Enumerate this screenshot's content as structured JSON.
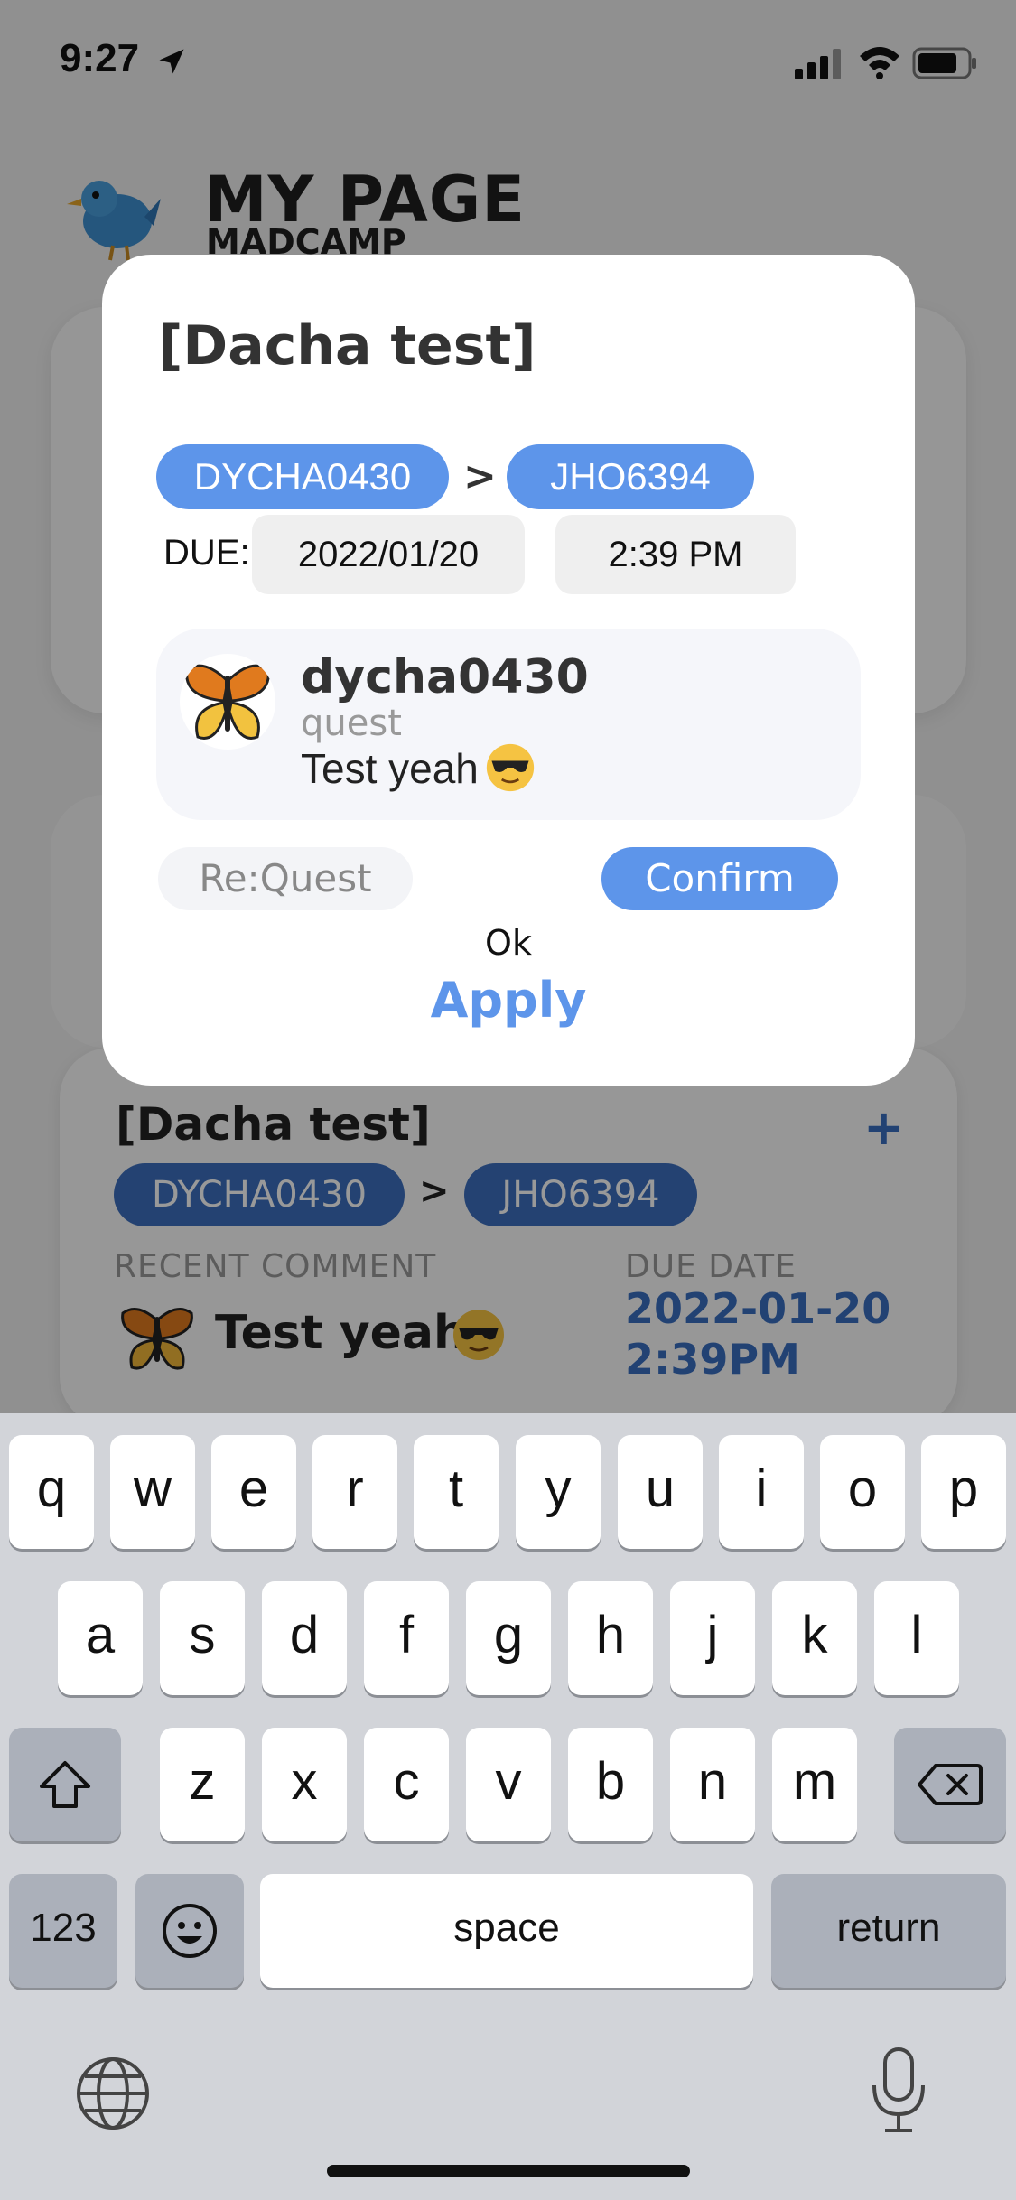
{
  "status_bar": {
    "time": "9:27"
  },
  "header": {
    "title": "MY PAGE",
    "subtitle": "MADCAMP"
  },
  "quest_card": {
    "title": "[Dacha test]",
    "from_user": "DYCHA0430",
    "arrow": ">",
    "to_user": "JHO6394",
    "recent_comment_label": "RECENT COMMENT",
    "recent_comment_text": "Test yeah",
    "due_date_label": "DUE DATE",
    "due_date": "2022-01-20",
    "due_time": "2:39PM",
    "add_label": "+"
  },
  "modal": {
    "title": "[Dacha test]",
    "from_user": "DYCHA0430",
    "arrow": ">",
    "to_user": "JHO6394",
    "due_label": "DUE:",
    "due_date": "2022/01/20",
    "due_time": "2:39 PM",
    "comment": {
      "username": "dycha0430",
      "type": "quest",
      "text": "Test yeah"
    },
    "request_label": "Re:Quest",
    "confirm_label": "Confirm",
    "ok_label": "Ok",
    "apply_label": "Apply"
  },
  "keyboard": {
    "row1": [
      "q",
      "w",
      "e",
      "r",
      "t",
      "y",
      "u",
      "i",
      "o",
      "p"
    ],
    "row2": [
      "a",
      "s",
      "d",
      "f",
      "g",
      "h",
      "j",
      "k",
      "l"
    ],
    "row3": [
      "z",
      "x",
      "c",
      "v",
      "b",
      "n",
      "m"
    ],
    "numbers_label": "123",
    "space_label": "space",
    "return_label": "return"
  },
  "colors": {
    "accent": "#5d95ea",
    "accent_dark": "#3c6fbe",
    "keyboard_bg": "#d2d4d9"
  },
  "icons": [
    "location-icon",
    "signal-icon",
    "wifi-icon",
    "battery-icon",
    "bird-icon",
    "butterfly-icon",
    "sunglasses-emoji-icon",
    "add-icon",
    "shift-icon",
    "delete-icon",
    "emoji-icon",
    "globe-icon",
    "mic-icon"
  ]
}
